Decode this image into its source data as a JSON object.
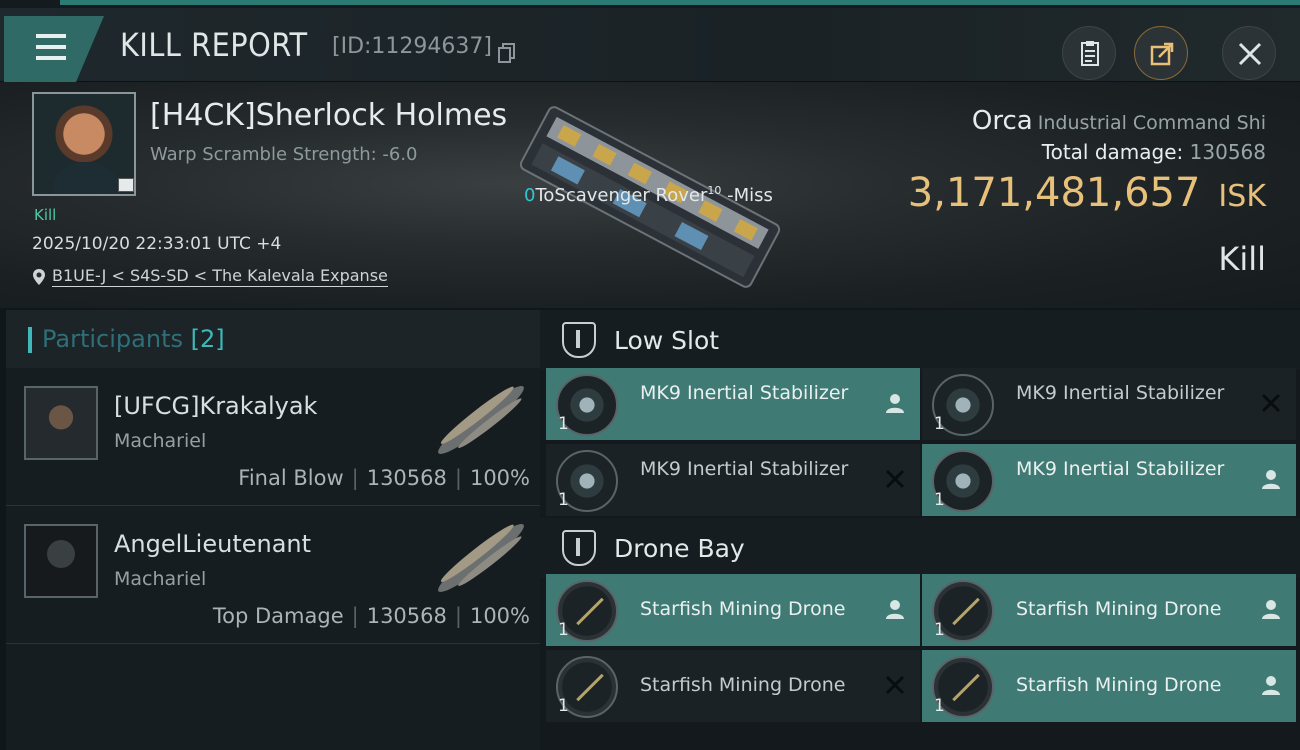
{
  "header": {
    "title": "KILL REPORT",
    "report_id": "[ID:11294637]"
  },
  "victim": {
    "pilot_name": "[H4CK]Sherlock Holmes",
    "warp_scramble": "Warp Scramble Strength: -6.0",
    "kill_tag": "Kill",
    "datetime": "2025/10/20 22:33:01 UTC +4",
    "location": "B1UE-J < S4S-SD < The Kalevala Expanse",
    "ship_name_prefix": "0",
    "ship_name": "ToScavenger Rover",
    "ship_name_sup": "10",
    "ship_name_suffix": " -Miss",
    "ship_type": "Orca",
    "ship_class": "Industrial Command Shi",
    "total_damage_label": "Total damage:",
    "total_damage": "130568",
    "isk_value": "3,171,481,657",
    "isk_unit": "ISK",
    "report_type": "Kill"
  },
  "participants": {
    "label": "Participants",
    "count": "[2]",
    "list": [
      {
        "name": "[UFCG]Krakalyak",
        "ship": "Machariel",
        "role": "Final Blow",
        "damage": "130568",
        "percent": "100%"
      },
      {
        "name": "AngelLieutenant",
        "ship": "Machariel",
        "role": "Top Damage",
        "damage": "130568",
        "percent": "100%"
      }
    ]
  },
  "sections": {
    "low_slot": "Low Slot",
    "drone_bay": "Drone Bay"
  },
  "modules": {
    "low_slot": [
      {
        "name": "MK9 Inertial Stabilizer",
        "qty": "1",
        "status": "dropped"
      },
      {
        "name": "MK9 Inertial Stabilizer",
        "qty": "1",
        "status": "destroyed"
      },
      {
        "name": "MK9 Inertial Stabilizer",
        "qty": "1",
        "status": "destroyed"
      },
      {
        "name": "MK9 Inertial Stabilizer",
        "qty": "1",
        "status": "dropped"
      }
    ],
    "drone_bay": [
      {
        "name": "Starfish Mining Drone",
        "qty": "1",
        "status": "dropped"
      },
      {
        "name": "Starfish Mining Drone",
        "qty": "1",
        "status": "dropped"
      },
      {
        "name": "Starfish Mining Drone",
        "qty": "1",
        "status": "destroyed"
      },
      {
        "name": "Starfish Mining Drone",
        "qty": "1",
        "status": "dropped"
      }
    ]
  },
  "colors": {
    "accent": "#3f7a74",
    "isk": "#e7c07a",
    "kill_tag": "#4ec9a7"
  },
  "icons": [
    "menu-icon",
    "copy-icon",
    "clipboard-icon",
    "share-icon",
    "close-icon",
    "location-pin-icon",
    "low-slot-icon",
    "drone-bay-icon",
    "person-icon",
    "x-icon"
  ]
}
